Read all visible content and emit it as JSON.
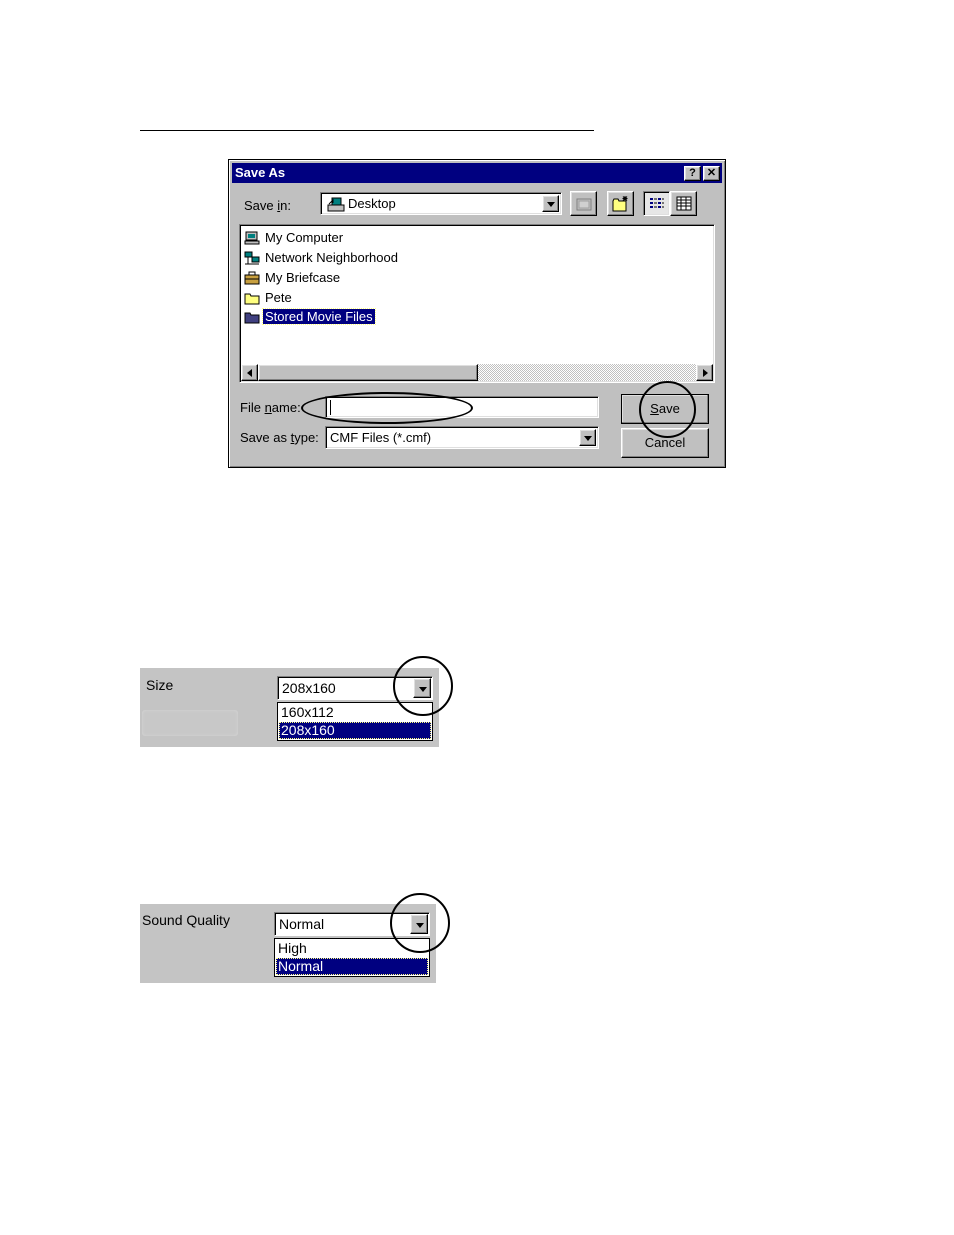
{
  "dialog": {
    "title": "Save As",
    "help_label": "?",
    "close_label": "✕",
    "save_in_label_pre": "Save ",
    "save_in_label_u": "i",
    "save_in_label_post": "n:",
    "save_in_value": "Desktop",
    "files": [
      {
        "label": "My Computer",
        "icon": "computer-icon"
      },
      {
        "label": "Network Neighborhood",
        "icon": "network-icon"
      },
      {
        "label": "My Briefcase",
        "icon": "briefcase-icon"
      },
      {
        "label": "Pete",
        "icon": "folder-icon"
      },
      {
        "label": "Stored Movie Files",
        "icon": "folder-icon",
        "selected": true
      }
    ],
    "file_name_label_pre": "File ",
    "file_name_label_u": "n",
    "file_name_label_post": "ame:",
    "file_name_value": "",
    "save_type_label_pre": "Save as ",
    "save_type_label_u": "t",
    "save_type_label_post": "ype:",
    "save_type_value": "CMF Files (*.cmf)",
    "save_button_u": "S",
    "save_button_rest": "ave",
    "cancel_button": "Cancel"
  },
  "size_panel": {
    "label": "Size",
    "value": "208x160",
    "options": [
      "160x112",
      "208x160"
    ],
    "selected_index": 1
  },
  "sound_panel": {
    "label": "Sound Quality",
    "value": "Normal",
    "options": [
      "High",
      "Normal"
    ],
    "selected_index": 1
  },
  "colors": {
    "title_bar": "#000080",
    "selection": "#000080",
    "face": "#c0c0c0"
  }
}
